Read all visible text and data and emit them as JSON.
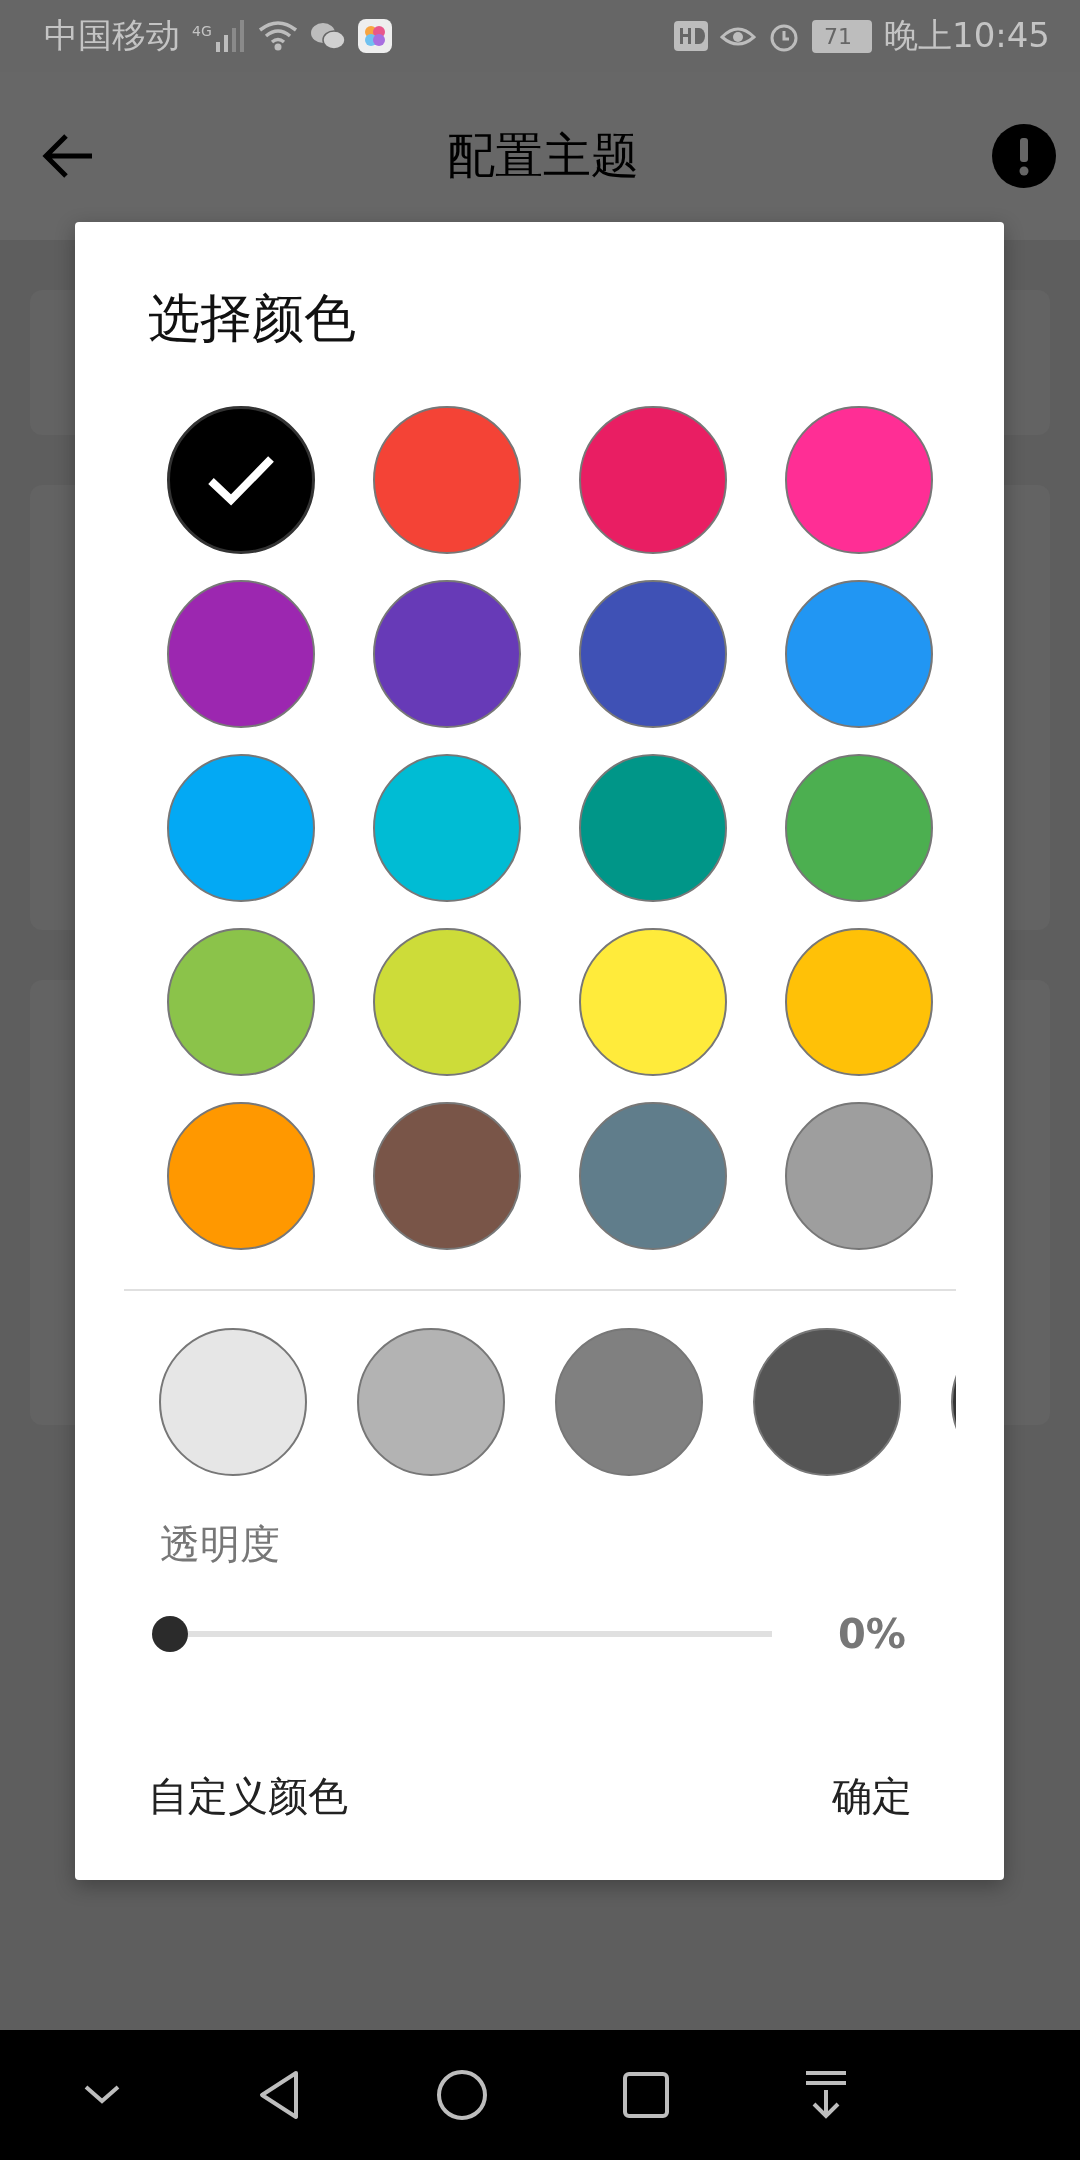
{
  "status_bar": {
    "carrier": "中国移动",
    "network": "4G",
    "battery": "71",
    "time": "晚上10:45"
  },
  "app_bar": {
    "title": "配置主题"
  },
  "dialog": {
    "title": "选择颜色",
    "swatches": [
      {
        "color": "#000000",
        "selected": true
      },
      {
        "color": "#f44336",
        "selected": false
      },
      {
        "color": "#e91e63",
        "selected": false
      },
      {
        "color": "#ff2e95",
        "selected": false
      },
      {
        "color": "#9c27b0",
        "selected": false
      },
      {
        "color": "#673ab7",
        "selected": false
      },
      {
        "color": "#3f51b5",
        "selected": false
      },
      {
        "color": "#2196f3",
        "selected": false
      },
      {
        "color": "#03a9f4",
        "selected": false
      },
      {
        "color": "#00bcd4",
        "selected": false
      },
      {
        "color": "#009688",
        "selected": false
      },
      {
        "color": "#4caf50",
        "selected": false
      },
      {
        "color": "#8bc34a",
        "selected": false
      },
      {
        "color": "#cddc39",
        "selected": false
      },
      {
        "color": "#ffeb3b",
        "selected": false
      },
      {
        "color": "#ffc107",
        "selected": false
      },
      {
        "color": "#ff9800",
        "selected": false
      },
      {
        "color": "#795548",
        "selected": false
      },
      {
        "color": "#607d8b",
        "selected": false
      },
      {
        "color": "#9e9e9e",
        "selected": false
      }
    ],
    "shades": [
      {
        "color": "#e6e6e6",
        "selected": false
      },
      {
        "color": "#b3b3b3",
        "selected": false
      },
      {
        "color": "#808080",
        "selected": false
      },
      {
        "color": "#555555",
        "selected": false
      },
      {
        "color": "#333333",
        "selected": false
      }
    ],
    "opacity": {
      "label": "透明度",
      "level": 0,
      "reading": "0%"
    },
    "buttons": [
      {
        "label": "自定义颜色"
      },
      {
        "label": "确定"
      }
    ]
  }
}
